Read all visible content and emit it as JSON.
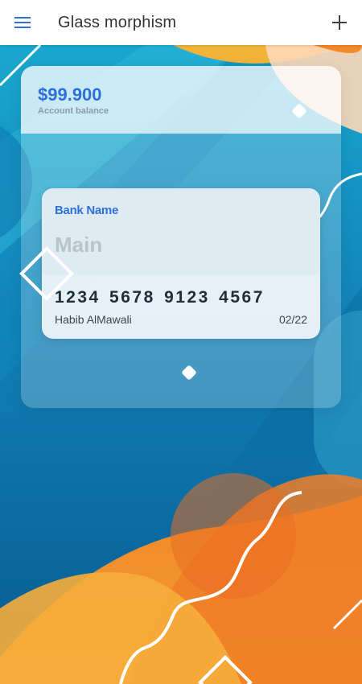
{
  "app": {
    "title": "Glass morphism",
    "menu_icon": "menu-icon",
    "add_icon": "plus-icon"
  },
  "account": {
    "balance": "$99.900",
    "balance_label": "Account balance"
  },
  "card": {
    "bank_name": "Bank Name",
    "type": "Main",
    "number": "1234 5678 9123 4567",
    "holder": "Habib AlMawali",
    "expiry": "02/22"
  },
  "colors": {
    "accent": "#2f6fd8",
    "orange": "#f08a2a",
    "light_orange": "#f6a63a",
    "blue_dark": "#0a5d93",
    "blue_light": "#3fb2d4"
  }
}
